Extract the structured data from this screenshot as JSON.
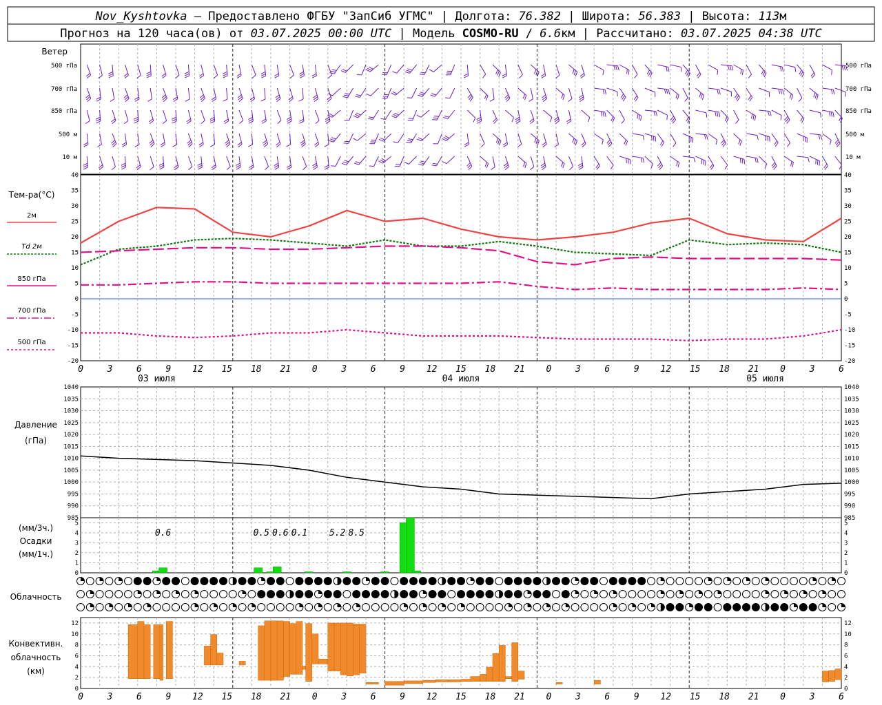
{
  "title": {
    "station": "Nov_Kyshtovka",
    "provider": " – Предоставлено ФГБУ \"ЗапСиб УГМС\" | Долгота: ",
    "lon": "76.382",
    "lat_label": " | Широта: ",
    "lat": "56.383",
    "alt_label": " | Высота: ",
    "alt": "113",
    "alt_unit": "м"
  },
  "subtitle": {
    "prefix": "Прогноз на 120 часа(ов) от ",
    "run": "03.07.2025 00:00 UTC",
    "model_label": "  | Модель ",
    "model": "COSMO-RU",
    "model_sep": " / ",
    "res": "6.6",
    "res_unit": "км",
    "calc_label": " | Рассчитано: ",
    "calc": "03.07.2025 04:38 UTC"
  },
  "hour_ticks": [
    "0",
    "3",
    "6",
    "9",
    "12",
    "15",
    "18",
    "21",
    "0",
    "3",
    "6",
    "9",
    "12",
    "15",
    "18",
    "21",
    "0",
    "3",
    "6",
    "9",
    "12",
    "15",
    "18",
    "21",
    "0",
    "3",
    "6"
  ],
  "day_labels": [
    "03 июля",
    "04 июля",
    "05 июля"
  ],
  "wind_panel": {
    "title": "Ветер",
    "levels": [
      "500 гПа",
      "700 гПа",
      "850 гПа",
      "500 м",
      "10 м"
    ]
  },
  "temp_panel": {
    "title": "Тем-ра(°C)",
    "legend": [
      "2м",
      "Td 2м",
      "850 гПа",
      "700 гПа",
      "500 гПа"
    ],
    "ticks": [
      "40",
      "35",
      "30",
      "25",
      "20",
      "15",
      "10",
      "5",
      "0",
      "-5",
      "-10",
      "-15",
      "-20"
    ],
    "colors": {
      "t2m": "#ee4444",
      "td2m": "#117711",
      "t850": "#dd1188",
      "t700": "#dd1188",
      "t500": "#dd1188",
      "zero": "#3355ff"
    }
  },
  "pressure_panel": {
    "title": "Давление",
    "unit": "(гПа)",
    "ticks": [
      "1040",
      "1035",
      "1030",
      "1025",
      "1020",
      "1015",
      "1010",
      "1005",
      "1000",
      "995",
      "990",
      "985"
    ]
  },
  "precip_panel": {
    "title": "Осадки",
    "unit_top": "(мм/3ч.)",
    "unit_bottom": "(мм/1ч.)",
    "ticks": [
      "5",
      "4",
      "3",
      "2",
      "1",
      "0"
    ],
    "labels": [
      "0.6",
      "0.5",
      "0.6",
      "0.1",
      "5.2",
      "8.5"
    ],
    "color": "#11dd11"
  },
  "cloud_panel": {
    "title": "Облачность"
  },
  "conv_panel": {
    "title_lines": [
      "Конвективн.",
      "облачность",
      "(км)"
    ],
    "ticks": [
      "12",
      "10",
      "8",
      "6",
      "4",
      "2",
      "0"
    ],
    "color": "#f08a2a"
  },
  "chart_data": [
    {
      "type": "line",
      "panel": "temperature",
      "ylabel": "Тем-ра(°C)",
      "ylim": [
        -20,
        40
      ],
      "x_unit": "hours since 03.07.2025 00:00 UTC",
      "x": [
        0,
        6,
        12,
        18,
        24,
        30,
        36,
        42,
        48,
        54,
        60,
        66,
        72,
        78,
        84,
        90,
        96,
        102,
        108,
        114,
        120
      ],
      "series": [
        {
          "name": "2м",
          "values": [
            18,
            25,
            29.5,
            29,
            21.5,
            20,
            23.5,
            28.5,
            25,
            26,
            22.5,
            20,
            19,
            20,
            21.5,
            24.5,
            26,
            21,
            19,
            18.5,
            26
          ]
        },
        {
          "name": "Td 2м",
          "values": [
            11,
            16,
            17,
            19,
            19.5,
            19,
            18,
            17,
            19,
            17,
            17,
            18.5,
            17,
            15,
            14.5,
            14,
            19,
            17.5,
            18,
            17.5,
            15
          ]
        },
        {
          "name": "850 гПа",
          "values": [
            15,
            15.5,
            16,
            16.5,
            16.5,
            16,
            16,
            16.5,
            17,
            17,
            16.5,
            15.5,
            12,
            11,
            13,
            13.5,
            13,
            13,
            13,
            13,
            12.5
          ]
        },
        {
          "name": "700 гПа",
          "values": [
            4.5,
            4.5,
            5,
            5.5,
            5.5,
            5,
            5,
            5,
            5,
            5,
            5,
            5.5,
            4,
            3,
            3.5,
            3,
            3,
            3,
            3,
            3.5,
            3
          ]
        },
        {
          "name": "500 гПа",
          "values": [
            -11,
            -11,
            -12,
            -12.5,
            -12,
            -11,
            -11,
            -10,
            -11,
            -12,
            -12,
            -12,
            -12.5,
            -13,
            -13,
            -13,
            -13.5,
            -13,
            -13,
            -12,
            -10
          ]
        }
      ]
    },
    {
      "type": "line",
      "panel": "pressure",
      "ylabel": "Давление",
      "ylim": [
        985,
        1040
      ],
      "x_unit": "hours since 03.07.2025 00:00 UTC",
      "x": [
        0,
        6,
        12,
        18,
        24,
        30,
        36,
        42,
        48,
        54,
        60,
        66,
        72,
        78,
        84,
        90,
        96,
        102,
        108,
        114,
        120
      ],
      "series": [
        {
          "name": "Давление",
          "values": [
            1011,
            1010,
            1009.5,
            1009,
            1008,
            1007,
            1005,
            1002,
            1000,
            998,
            997,
            995,
            994.5,
            994,
            993.5,
            993,
            995,
            996,
            997,
            999,
            999.5
          ]
        }
      ]
    },
    {
      "type": "bar",
      "panel": "precipitation",
      "ylabel": "Осадки",
      "ylim": [
        0,
        5.5
      ],
      "x_unit": "hours since 03.07.2025 00:00 UTC",
      "x": [
        12,
        13,
        28,
        30,
        31,
        36,
        42,
        48,
        51,
        52,
        53
      ],
      "values": [
        0.2,
        0.5,
        0.5,
        0.1,
        0.6,
        0.1,
        0.1,
        0.1,
        5.0,
        5.5,
        0.2
      ]
    },
    {
      "type": "bar",
      "panel": "convective_cloud",
      "ylabel": "Конвективн. облачность (км)",
      "ylim": [
        0,
        13
      ],
      "x_unit": "hours since 03.07.2025 00:00 UTC",
      "bars": [
        [
          7.5,
          9,
          1.8,
          11.7
        ],
        [
          9,
          10,
          1.8,
          12.3
        ],
        [
          10,
          11,
          1.8,
          11.7
        ],
        [
          11.5,
          12.5,
          1.8,
          11.7
        ],
        [
          12.5,
          13,
          1.5,
          11.7
        ],
        [
          13.5,
          14.5,
          1.8,
          12.3
        ],
        [
          19.5,
          20.5,
          4.3,
          7.8
        ],
        [
          20.5,
          21.5,
          4.3,
          9.9
        ],
        [
          21.5,
          22.5,
          4.3,
          6.5
        ],
        [
          25,
          26,
          4.3,
          5
        ],
        [
          28,
          29,
          1.5,
          11.5
        ],
        [
          29,
          30,
          1.5,
          12.4
        ],
        [
          30,
          31,
          1.5,
          12.4
        ],
        [
          31,
          32,
          1.5,
          12.4
        ],
        [
          32,
          33,
          2.2,
          12.3
        ],
        [
          33,
          34,
          2.6,
          11.9
        ],
        [
          34,
          35,
          2.6,
          12.3
        ],
        [
          35,
          35.5,
          3.5,
          4.1
        ],
        [
          35.5,
          36.5,
          1.3,
          11.9
        ],
        [
          36.5,
          37.5,
          4.5,
          10
        ],
        [
          37.5,
          39,
          4.5,
          5.4
        ],
        [
          39,
          40,
          3.2,
          12
        ],
        [
          40,
          41,
          3.2,
          12
        ],
        [
          41,
          42,
          2.5,
          12
        ],
        [
          42,
          43,
          2.3,
          12
        ],
        [
          43,
          44,
          2.5,
          11.8
        ],
        [
          44,
          45,
          2.8,
          11.8
        ],
        [
          45,
          46,
          0.8,
          1.1
        ],
        [
          46,
          47,
          0.8,
          1.1
        ],
        [
          48,
          51,
          0.6,
          1.3
        ],
        [
          51,
          54,
          0.9,
          1.4
        ],
        [
          54,
          56,
          1.1,
          1.5
        ],
        [
          56,
          58,
          1.2,
          1.6
        ],
        [
          58,
          60,
          1.2,
          1.6
        ],
        [
          60,
          61.5,
          1.3,
          1.7
        ],
        [
          61.5,
          63,
          1.3,
          2.2
        ],
        [
          63,
          64,
          1.3,
          2.6
        ],
        [
          64,
          65,
          1.3,
          3.9
        ],
        [
          65,
          66,
          1.3,
          6.4
        ],
        [
          66,
          67,
          1.3,
          7.9
        ],
        [
          67,
          68,
          1.8,
          2.2
        ],
        [
          68,
          69,
          1.3,
          8.4
        ],
        [
          69,
          70,
          1.7,
          3.2
        ],
        [
          75,
          76,
          0.8,
          1.1
        ],
        [
          81,
          82,
          0.8,
          1.5
        ],
        [
          117,
          118,
          1.2,
          3.2
        ],
        [
          118,
          119,
          1.3,
          3.3
        ],
        [
          119,
          120,
          1.6,
          3.6
        ]
      ]
    }
  ]
}
